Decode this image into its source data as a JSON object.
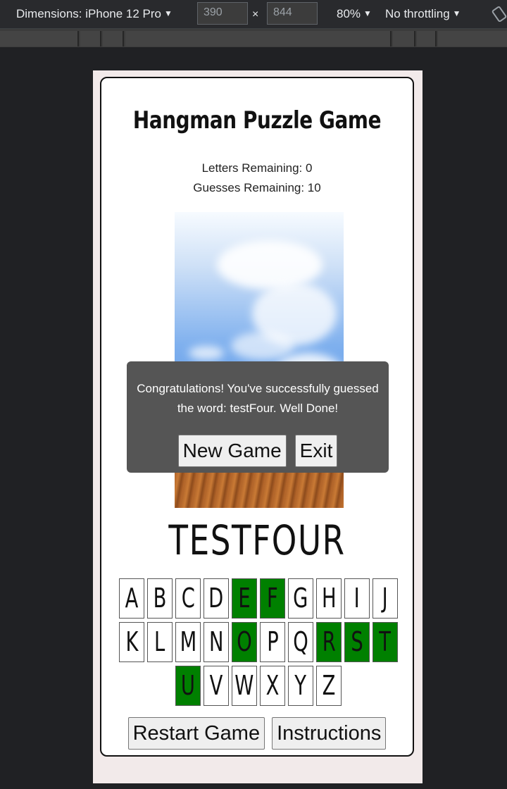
{
  "devtools": {
    "dimensions_label": "Dimensions: iPhone 12 Pro",
    "width_value": "390",
    "height_value": "844",
    "times": "×",
    "zoom": "80%",
    "throttling": "No throttling",
    "caret": "▼"
  },
  "game": {
    "title": "Hangman Puzzle Game",
    "letters_remaining": "Letters Remaining: 0",
    "guesses_remaining": "Guesses Remaining: 10",
    "word": "TESTFOUR",
    "keyboard_rows": [
      [
        {
          "l": "A",
          "used": false
        },
        {
          "l": "B",
          "used": false
        },
        {
          "l": "C",
          "used": false
        },
        {
          "l": "D",
          "used": false
        },
        {
          "l": "E",
          "used": true
        },
        {
          "l": "F",
          "used": true
        },
        {
          "l": "G",
          "used": false
        },
        {
          "l": "H",
          "used": false
        },
        {
          "l": "I",
          "used": false
        },
        {
          "l": "J",
          "used": false
        }
      ],
      [
        {
          "l": "K",
          "used": false
        },
        {
          "l": "L",
          "used": false
        },
        {
          "l": "M",
          "used": false
        },
        {
          "l": "N",
          "used": false
        },
        {
          "l": "O",
          "used": true
        },
        {
          "l": "P",
          "used": false
        },
        {
          "l": "Q",
          "used": false
        },
        {
          "l": "R",
          "used": true
        },
        {
          "l": "S",
          "used": true
        },
        {
          "l": "T",
          "used": true
        }
      ],
      [
        {
          "l": "U",
          "used": true
        },
        {
          "l": "V",
          "used": false
        },
        {
          "l": "W",
          "used": false
        },
        {
          "l": "X",
          "used": false
        },
        {
          "l": "Y",
          "used": false
        },
        {
          "l": "Z",
          "used": false
        }
      ]
    ],
    "restart_label": "Restart Game",
    "instructions_label": "Instructions",
    "used_color": "#008000"
  },
  "popup": {
    "message_line1": "Congratulations! You've successfully guessed",
    "message_line2": "the word: testFour. Well Done!",
    "new_game_label": "New Game",
    "exit_label": "Exit"
  }
}
